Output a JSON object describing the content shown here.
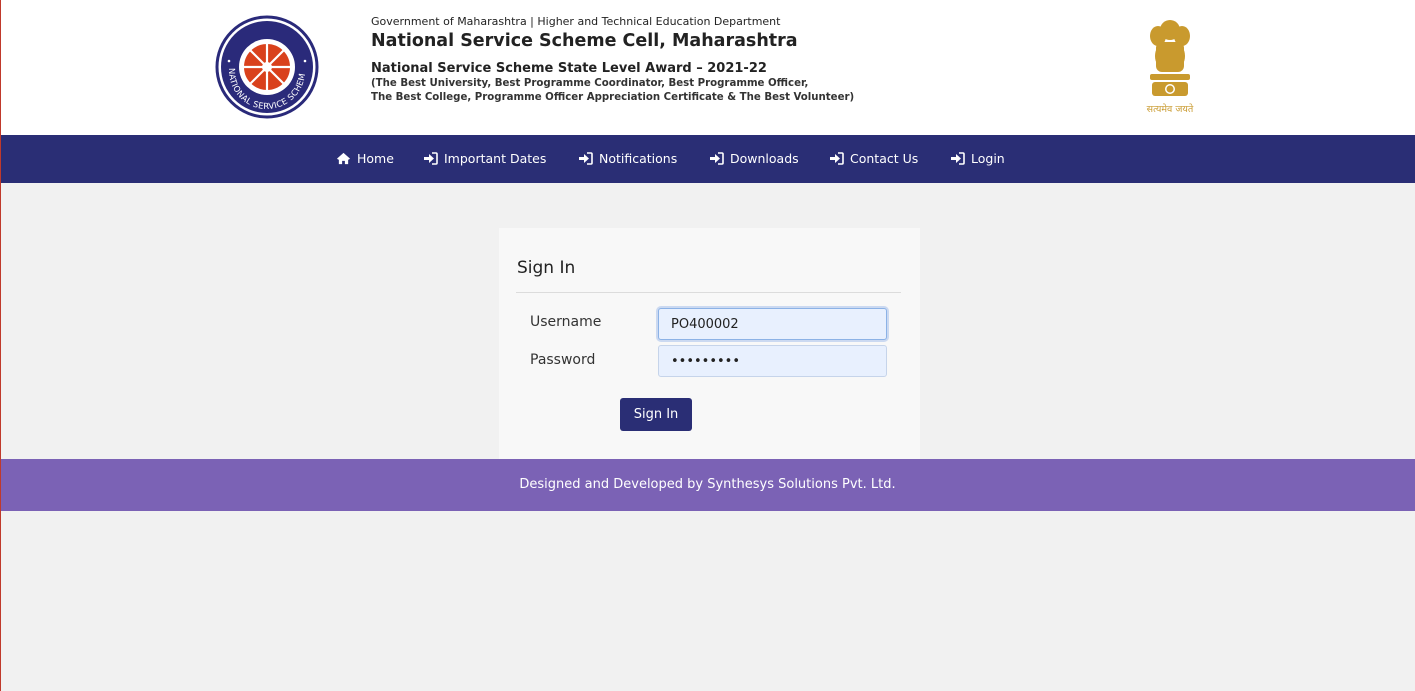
{
  "header": {
    "department_line": "Government of Maharashtra | Higher and Technical Education Department",
    "cell_title": "National Service Scheme Cell, Maharashtra",
    "award_title": "National Service Scheme State Level Award – 2021-22",
    "award_subtitle_line1": "(The Best University, Best Programme Coordinator, Best Programme Officer,",
    "award_subtitle_line2": "The Best College, Programme Officer Appreciation Certificate & The Best Volunteer)",
    "logo_icon": "nss-logo-icon",
    "logo_text": "NATIONAL SERVICE SCHEME",
    "emblem_icon": "ashoka-emblem-icon",
    "emblem_caption": "सत्यमेव जयते"
  },
  "nav": {
    "items": [
      {
        "label": "Home",
        "icon": "home-icon"
      },
      {
        "label": "Important Dates",
        "icon": "sign-in-arrow-icon"
      },
      {
        "label": "Notifications",
        "icon": "sign-in-arrow-icon"
      },
      {
        "label": "Downloads",
        "icon": "sign-in-arrow-icon"
      },
      {
        "label": "Contact Us",
        "icon": "sign-in-arrow-icon"
      },
      {
        "label": "Login",
        "icon": "sign-in-arrow-icon"
      }
    ]
  },
  "login": {
    "title": "Sign In",
    "username_label": "Username",
    "username_value": "PO400002",
    "password_label": "Password",
    "password_value": "•••••••••",
    "submit_label": "Sign In"
  },
  "footer": {
    "credit": "Designed and Developed by Synthesys Solutions Pvt. Ltd."
  },
  "colors": {
    "nav_bg": "#2a2e75",
    "footer_bg": "#7b62b5",
    "page_bg": "#f1f1f1",
    "logo_blue": "#2a2a7a",
    "logo_red": "#d9411c",
    "emblem_gold": "#c99a2e"
  }
}
